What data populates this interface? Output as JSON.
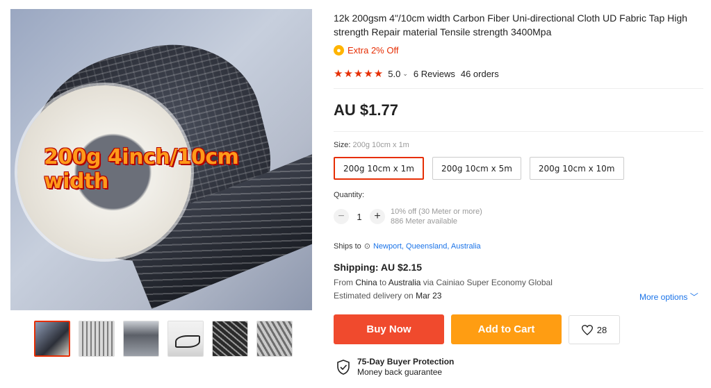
{
  "gallery": {
    "overlay_text": "200g 4inch/10cm width",
    "thumbnails": [
      "thumb-1",
      "thumb-2",
      "thumb-3",
      "thumb-4",
      "thumb-5",
      "thumb-6"
    ],
    "active_index": 0
  },
  "product": {
    "title": "12k 200gsm 4\"/10cm width Carbon Fiber Uni-directional Cloth UD Fabric Tap High strength Repair material Tensile strength 3400Mpa",
    "extra_off": "Extra 2% Off",
    "rating_value": "5.0",
    "stars": "★★★★★",
    "reviews": "6 Reviews",
    "orders": "46 orders",
    "price": "AU $1.77"
  },
  "size": {
    "label": "Size:",
    "selected": "200g 10cm x 1m",
    "options": [
      "200g 10cm x 1m",
      "200g 10cm x 5m",
      "200g 10cm x 10m"
    ]
  },
  "quantity": {
    "label": "Quantity:",
    "minus": "−",
    "plus": "+",
    "value": "1",
    "discount_note": "10% off (30 Meter or more)",
    "available": "886 Meter available"
  },
  "shipping": {
    "ships_to_label": "Ships to",
    "location": "Newport, Queensland, Australia",
    "price": "Shipping: AU $2.15",
    "from_label": "From",
    "from": "China",
    "to_label": "to",
    "to": "Australia",
    "via": "via Cainiao Super Economy Global",
    "eta_label": "Estimated delivery on",
    "eta": "Mar 23",
    "more_options": "More options"
  },
  "actions": {
    "buy_now": "Buy Now",
    "add_to_cart": "Add to Cart",
    "wishlist_count": "28"
  },
  "protection": {
    "title": "75-Day Buyer Protection",
    "subtitle": "Money back guarantee"
  },
  "colors": {
    "accent_red": "#e62e04",
    "buy_now": "#f04a2d",
    "add_to_cart": "#ff9d12",
    "link_blue": "#1a73e8"
  }
}
